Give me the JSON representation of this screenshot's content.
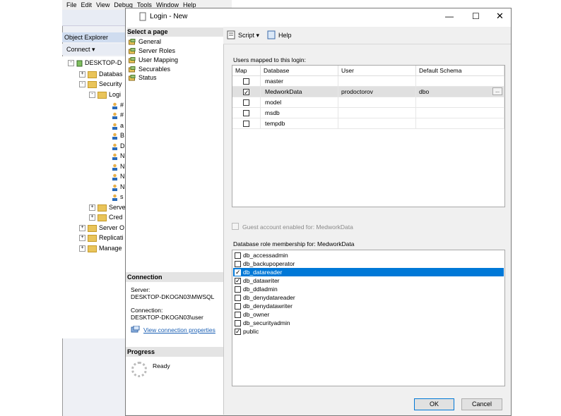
{
  "ssms": {
    "menu": [
      "File",
      "Edit",
      "View",
      "Debug",
      "Tools",
      "Window",
      "Help"
    ],
    "object_explorer_title": "Object Explorer",
    "connect_label": "Connect ▾",
    "tree": [
      {
        "label": "DESKTOP-D",
        "kind": "server"
      },
      {
        "label": "Databas",
        "kind": "folder"
      },
      {
        "label": "Security",
        "kind": "folder"
      },
      {
        "label": "Logi",
        "kind": "folder"
      },
      {
        "label": "#",
        "kind": "user"
      },
      {
        "label": "#",
        "kind": "user"
      },
      {
        "label": "a",
        "kind": "user"
      },
      {
        "label": "B",
        "kind": "user"
      },
      {
        "label": "D",
        "kind": "user"
      },
      {
        "label": "N",
        "kind": "user"
      },
      {
        "label": "N",
        "kind": "user"
      },
      {
        "label": "N",
        "kind": "user"
      },
      {
        "label": "N",
        "kind": "user"
      },
      {
        "label": "s",
        "kind": "user"
      },
      {
        "label": "Serve",
        "kind": "folder"
      },
      {
        "label": "Cred",
        "kind": "folder"
      },
      {
        "label": "Server O",
        "kind": "folder"
      },
      {
        "label": "Replicati",
        "kind": "folder"
      },
      {
        "label": "Manage",
        "kind": "folder"
      }
    ]
  },
  "dialog": {
    "title": "Login - New",
    "select_page_header": "Select a page",
    "pages": [
      "General",
      "Server Roles",
      "User Mapping",
      "Securables",
      "Status"
    ],
    "script_label": "Script",
    "help_label": "Help",
    "connection_header": "Connection",
    "server_label": "Server:",
    "server_value": "DESKTOP-DKOGN03\\MWSQL",
    "connection_label": "Connection:",
    "connection_value": "DESKTOP-DKOGN03\\user",
    "view_connection_link": "View connection properties",
    "progress_header": "Progress",
    "progress_status": "Ready",
    "users_mapped_label": "Users mapped to this login:",
    "grid_headers": [
      "Map",
      "Database",
      "User",
      "Default Schema"
    ],
    "mappings": [
      {
        "map": false,
        "database": "master",
        "user": "",
        "schema": ""
      },
      {
        "map": true,
        "database": "MedworkData",
        "user": "prodoctorov",
        "schema": "dbo"
      },
      {
        "map": false,
        "database": "model",
        "user": "",
        "schema": ""
      },
      {
        "map": false,
        "database": "msdb",
        "user": "",
        "schema": ""
      },
      {
        "map": false,
        "database": "tempdb",
        "user": "",
        "schema": ""
      }
    ],
    "ellipsis": "...",
    "guest_label": "Guest account enabled for: MedworkData",
    "role_membership_label": "Database role membership for: MedworkData",
    "roles": [
      {
        "name": "db_accessadmin",
        "checked": false
      },
      {
        "name": "db_backupoperator",
        "checked": false
      },
      {
        "name": "db_datareader",
        "checked": true
      },
      {
        "name": "db_datawriter",
        "checked": true
      },
      {
        "name": "db_ddladmin",
        "checked": false
      },
      {
        "name": "db_denydatareader",
        "checked": false
      },
      {
        "name": "db_denydatawriter",
        "checked": false
      },
      {
        "name": "db_owner",
        "checked": false
      },
      {
        "name": "db_securityadmin",
        "checked": false
      },
      {
        "name": "public",
        "checked": true
      }
    ],
    "selected_role": "db_datareader",
    "ok_label": "OK",
    "cancel_label": "Cancel",
    "min_glyph": "—",
    "max_glyph": "☐",
    "close_glyph": "✕"
  }
}
